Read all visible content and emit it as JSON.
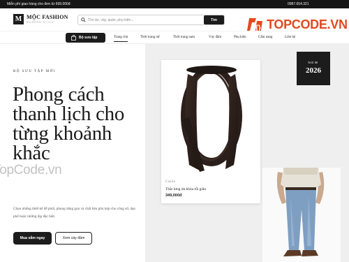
{
  "topbar": {
    "promo": "Miễn phí giao hàng cho đơn từ 699.000đ",
    "phone": "0987.654.321"
  },
  "header": {
    "logo_letter": "M",
    "logo_name": "MỘC FASHION",
    "logo_tagline": "MODERN STYLE",
    "search_placeholder": "Tìm áo, váy, quần, phụ kiện...",
    "search_button": "Tìm"
  },
  "watermark": {
    "brand": "TOPCODE.VN",
    "overlay": "TopCode.vn"
  },
  "nav": {
    "collection_button": "Bộ sưu tập",
    "items": [
      {
        "label": "Trang chủ",
        "active": true
      },
      {
        "label": "Thời trang nữ"
      },
      {
        "label": "Thời trang nam"
      },
      {
        "label": "Váy đầm"
      },
      {
        "label": "Phụ kiện"
      },
      {
        "label": "Cẩm nang"
      },
      {
        "label": "Liên hệ"
      }
    ]
  },
  "hero": {
    "eyebrow": "BỘ SƯU TẬP MỚI",
    "headline": "Phong cách thanh lịch cho từng khoảnh khắc",
    "description": "Chọn những thiết kế để phối, phong dáng gọn và chất liệu phù hợp cho công sở, dạo phố hoặc những dịp đặc biệt.",
    "primary_button": "Mua sắm ngay",
    "secondary_button": "Xem váy đầm"
  },
  "badge": {
    "label": "NEW",
    "year": "2026"
  },
  "product_card": {
    "brand": "Casile",
    "name": "Thắt lưng da khóa tối giản",
    "price": "349,000đ"
  },
  "colors": {
    "dark": "#1c1c1c",
    "accent_watermark": "#e14a1f",
    "panel_bg": "#efefef"
  }
}
